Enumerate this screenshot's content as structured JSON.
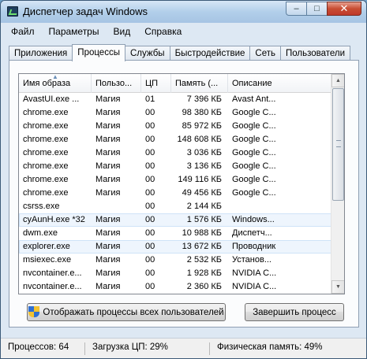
{
  "window": {
    "title": "Диспетчер задач Windows",
    "controls": {
      "minimize": "–",
      "maximize": "□",
      "close": "✕"
    }
  },
  "menu": [
    "Файл",
    "Параметры",
    "Вид",
    "Справка"
  ],
  "tabs": [
    "Приложения",
    "Процессы",
    "Службы",
    "Быстродействие",
    "Сеть",
    "Пользователи"
  ],
  "active_tab": "Процессы",
  "columns": [
    "Имя образа",
    "Пользо...",
    "ЦП",
    "Память (...",
    "Описание"
  ],
  "sort_indicator": "▲",
  "rows": [
    {
      "name": "AvastUI.exe ...",
      "user": "Магия",
      "cpu": "01",
      "mem": "7 396 КБ",
      "desc": "Avast Ant..."
    },
    {
      "name": "chrome.exe",
      "user": "Магия",
      "cpu": "00",
      "mem": "98 380 КБ",
      "desc": "Google C..."
    },
    {
      "name": "chrome.exe",
      "user": "Магия",
      "cpu": "00",
      "mem": "85 972 КБ",
      "desc": "Google C..."
    },
    {
      "name": "chrome.exe",
      "user": "Магия",
      "cpu": "00",
      "mem": "148 608 КБ",
      "desc": "Google C..."
    },
    {
      "name": "chrome.exe",
      "user": "Магия",
      "cpu": "00",
      "mem": "3 036 КБ",
      "desc": "Google C..."
    },
    {
      "name": "chrome.exe",
      "user": "Магия",
      "cpu": "00",
      "mem": "3 136 КБ",
      "desc": "Google C..."
    },
    {
      "name": "chrome.exe",
      "user": "Магия",
      "cpu": "00",
      "mem": "149 116 КБ",
      "desc": "Google C..."
    },
    {
      "name": "chrome.exe",
      "user": "Магия",
      "cpu": "00",
      "mem": "49 456 КБ",
      "desc": "Google C..."
    },
    {
      "name": "csrss.exe",
      "user": "",
      "cpu": "00",
      "mem": "2 144 КБ",
      "desc": ""
    },
    {
      "name": "cyAunH.exe *32",
      "user": "Магия",
      "cpu": "00",
      "mem": "1 576 КБ",
      "desc": "Windows..."
    },
    {
      "name": "dwm.exe",
      "user": "Магия",
      "cpu": "00",
      "mem": "10 988 КБ",
      "desc": "Диспетч..."
    },
    {
      "name": "explorer.exe",
      "user": "Магия",
      "cpu": "00",
      "mem": "13 672 КБ",
      "desc": "Проводник"
    },
    {
      "name": "msiexec.exe",
      "user": "Магия",
      "cpu": "00",
      "mem": "2 532 КБ",
      "desc": "Установ..."
    },
    {
      "name": "nvcontainer.e...",
      "user": "Магия",
      "cpu": "00",
      "mem": "1 928 КБ",
      "desc": "NVIDIA C..."
    },
    {
      "name": "nvcontainer.e...",
      "user": "Магия",
      "cpu": "00",
      "mem": "2 360 КБ",
      "desc": "NVIDIA C..."
    }
  ],
  "highlighted_rows": [
    9,
    11
  ],
  "scrollbar": {
    "up": "▲",
    "down": "▼"
  },
  "buttons": {
    "show_all": "Отображать процессы всех пользователей",
    "end_process": "Завершить процесс"
  },
  "status": {
    "processes": "Процессов: 64",
    "cpu": "Загрузка ЦП: 29%",
    "memory": "Физическая память: 49%"
  }
}
